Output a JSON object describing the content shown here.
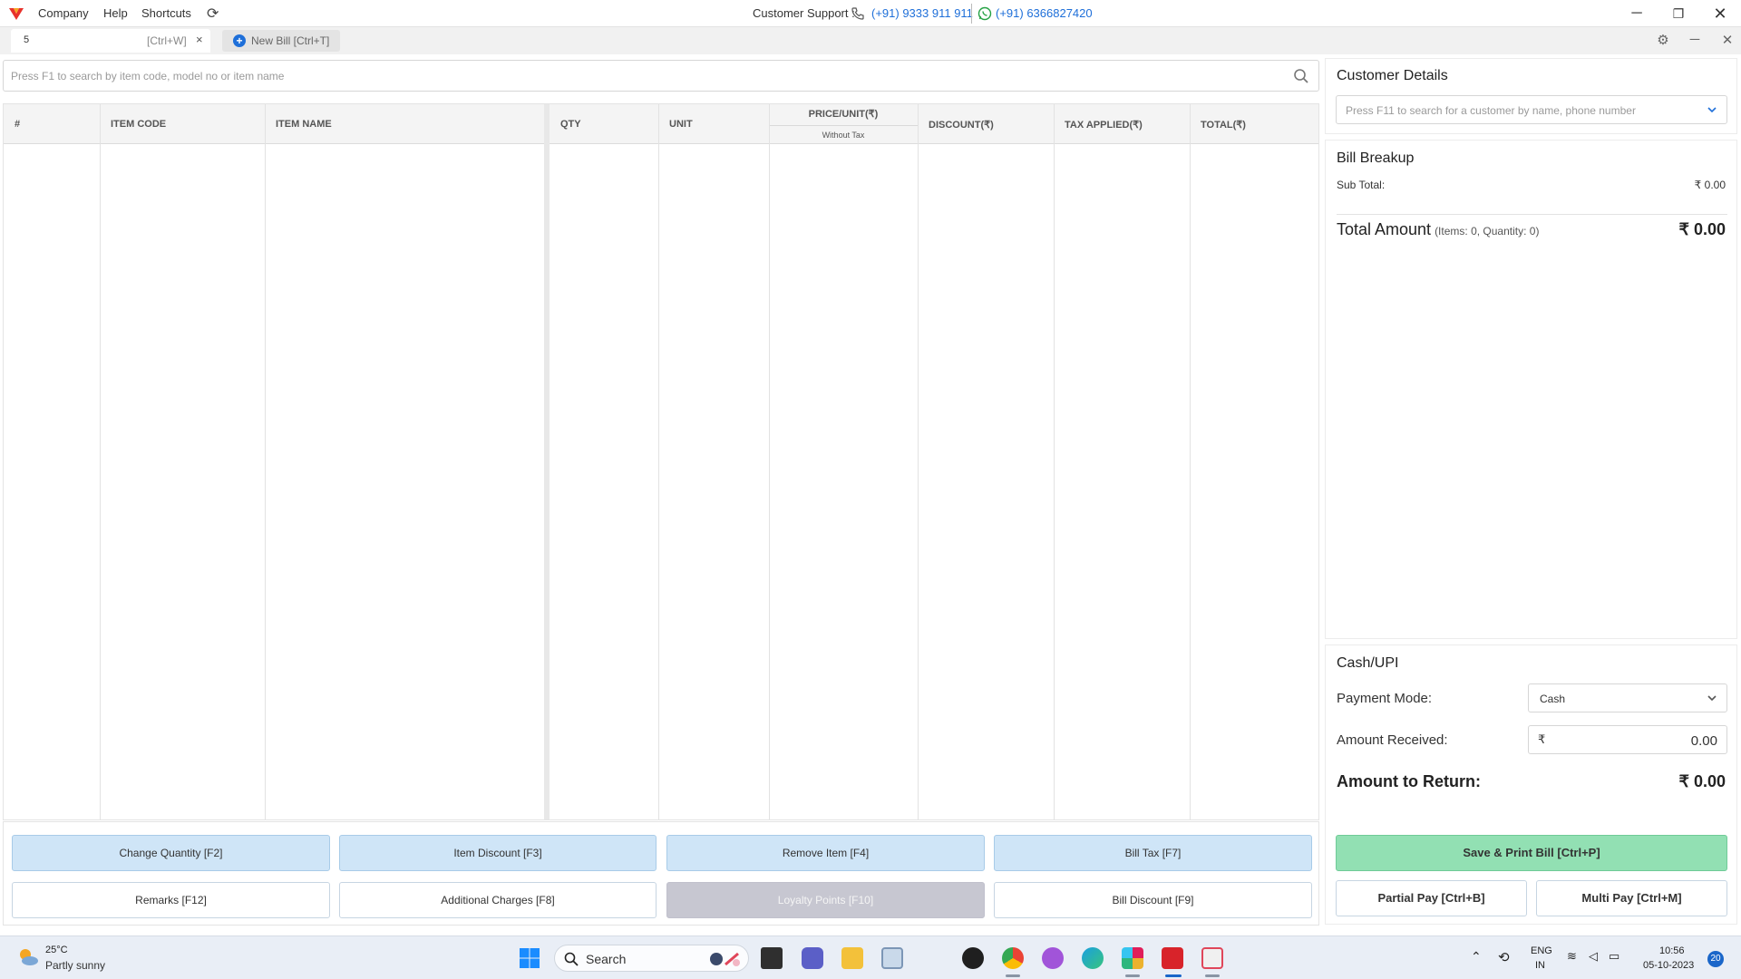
{
  "menubar": {
    "items": [
      "Company",
      "Help",
      "Shortcuts"
    ],
    "support_label": "Customer Support :",
    "phone_primary": "(+91) 9333 911 911",
    "phone_whatsapp": "(+91) 6366827420"
  },
  "tabs": {
    "active": {
      "label": "5",
      "shortcut": "[Ctrl+W]",
      "close": "×"
    },
    "new_bill_label": "New Bill [Ctrl+T]"
  },
  "item_search": {
    "placeholder": "Press F1 to search by item code, model no or item name",
    "value": ""
  },
  "table": {
    "headers": {
      "index": "#",
      "item_code": "ITEM CODE",
      "item_name": "ITEM NAME",
      "qty": "QTY",
      "unit": "UNIT",
      "price_unit": "PRICE/UNIT(₹)",
      "price_sub": "Without Tax",
      "discount": "DISCOUNT(₹)",
      "tax_applied": "TAX APPLIED(₹)",
      "total": "TOTAL(₹)"
    },
    "rows": []
  },
  "actions": {
    "change_quantity": "Change Quantity [F2]",
    "item_discount": "Item Discount [F3]",
    "remove_item": "Remove Item [F4]",
    "bill_tax": "Bill Tax [F7]",
    "remarks": "Remarks [F12]",
    "additional_charges": "Additional Charges [F8]",
    "loyalty_points": "Loyalty Points [F10]",
    "bill_discount": "Bill Discount [F9]"
  },
  "customer": {
    "title": "Customer Details",
    "placeholder": "Press F11 to search for a customer by name, phone number"
  },
  "bill_breakup": {
    "title": "Bill Breakup",
    "sub_total_label": "Sub Total:",
    "sub_total_value": "₹ 0.00",
    "total_label": "Total Amount",
    "total_meta": "(Items: 0, Quantity: 0)",
    "total_value": "₹ 0.00"
  },
  "payment": {
    "title": "Cash/UPI",
    "mode_label": "Payment Mode:",
    "mode_value": "Cash",
    "received_label": "Amount Received:",
    "currency": "₹",
    "received_value": "0.00",
    "return_label": "Amount to Return:",
    "return_value": "₹ 0.00",
    "save_print": "Save & Print Bill [Ctrl+P]",
    "partial_pay": "Partial Pay [Ctrl+B]",
    "multi_pay": "Multi Pay [Ctrl+M]"
  },
  "taskbar": {
    "temperature": "25°C",
    "weather": "Partly sunny",
    "search_label": "Search",
    "language_top": "ENG",
    "language_bottom": "IN",
    "time": "10:56",
    "date": "05-10-2023",
    "notifications": "20"
  },
  "colors": {
    "accent_blue": "#1e6fd9",
    "action_blue": "#cfe5f7",
    "save_green": "#92e0b3",
    "disabled_gray": "#c7c7d1",
    "brand_red": "#e8322b"
  }
}
